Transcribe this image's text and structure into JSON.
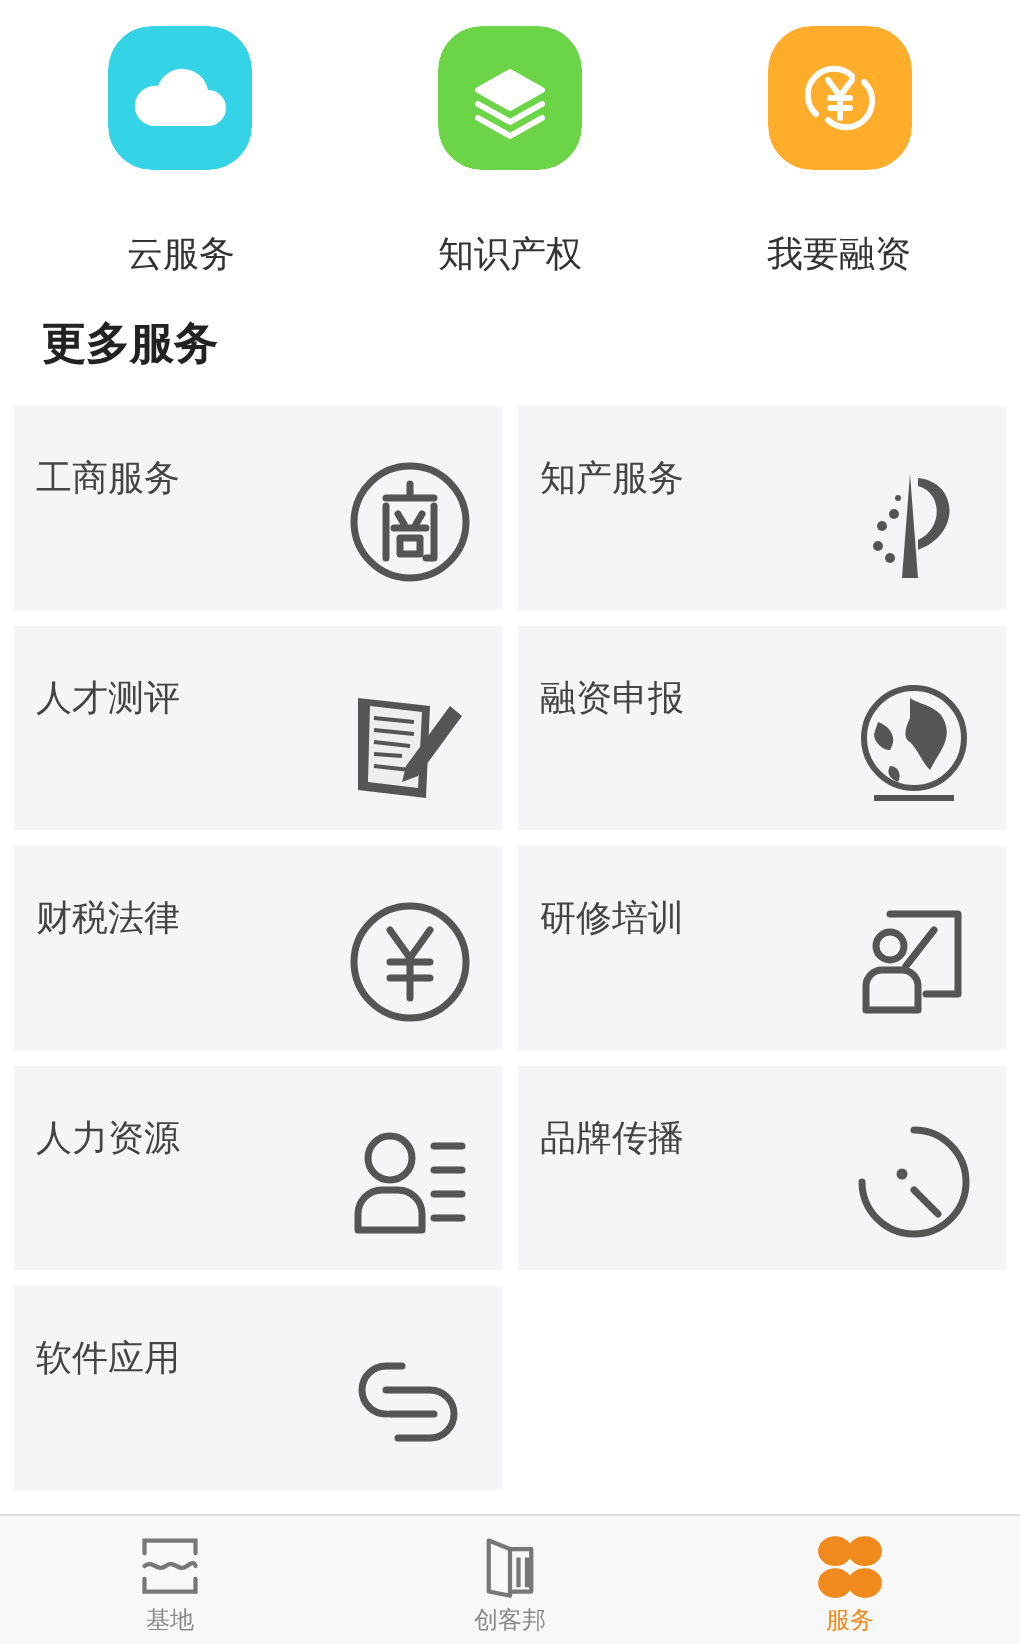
{
  "shortcuts": [
    {
      "label": "云服务",
      "kind": "cloud",
      "color": "#35d3e6"
    },
    {
      "label": "知识产权",
      "kind": "books",
      "color": "#6bd447"
    },
    {
      "label": "我要融资",
      "kind": "yen-cycle",
      "color": "#ffad2a"
    }
  ],
  "section_title": "更多服务",
  "services": [
    {
      "label": "工商服务",
      "kind": "shang"
    },
    {
      "label": "知产服务",
      "kind": "ip"
    },
    {
      "label": "人才测评",
      "kind": "notepad"
    },
    {
      "label": "融资申报",
      "kind": "globe"
    },
    {
      "label": "财税法律",
      "kind": "yen"
    },
    {
      "label": "研修培训",
      "kind": "teacher"
    },
    {
      "label": "人力资源",
      "kind": "person-list"
    },
    {
      "label": "品牌传播",
      "kind": "dial"
    },
    {
      "label": "软件应用",
      "kind": "link"
    }
  ],
  "tabs": [
    {
      "label": "基地",
      "kind": "base",
      "selected": false
    },
    {
      "label": "创客邦",
      "kind": "maker",
      "selected": false
    },
    {
      "label": "服务",
      "kind": "clover",
      "selected": true
    }
  ]
}
